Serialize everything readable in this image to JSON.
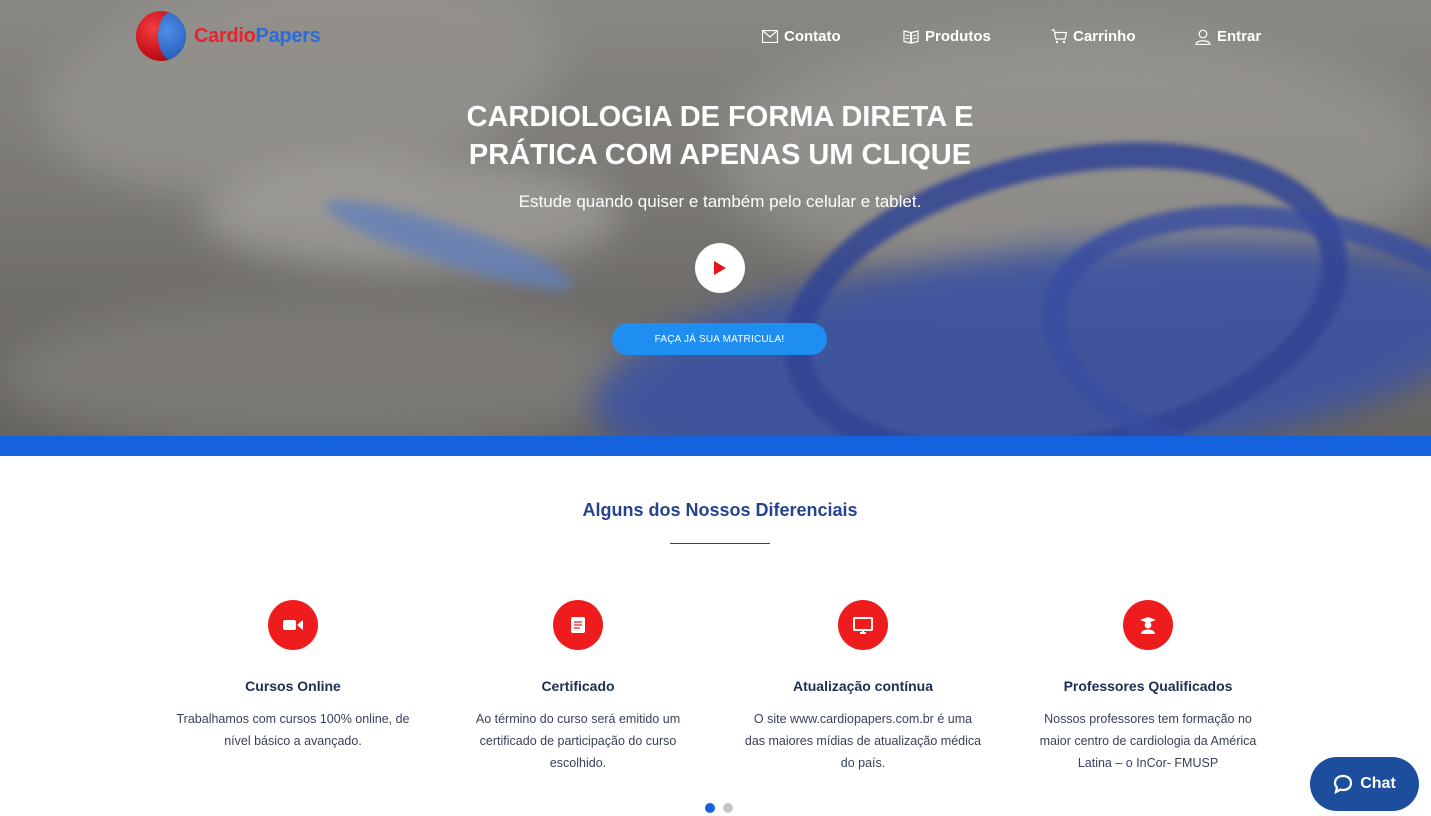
{
  "logo": {
    "part1": "Cardio",
    "part2": "Papers"
  },
  "nav": {
    "contato": {
      "label": "Contato",
      "icon": "envelope-icon"
    },
    "produtos": {
      "label": "Produtos",
      "icon": "book-icon"
    },
    "carrinho": {
      "label": "Carrinho",
      "icon": "cart-icon"
    },
    "entrar": {
      "label": "Entrar",
      "icon": "user-icon"
    }
  },
  "hero": {
    "title_line1": "CARDIOLOGIA DE FORMA DIRETA E",
    "title_line2": "PRÁTICA COM APENAS UM CLIQUE",
    "subtitle": "Estude quando quiser e também pelo celular e tablet.",
    "cta": "FAÇA JÁ SUA MATRICULA!"
  },
  "section": {
    "title": "Alguns dos Nossos Diferenciais"
  },
  "features": [
    {
      "icon": "video-camera-icon",
      "title": "Cursos Online",
      "desc": "Trabalhamos com cursos 100% online, de nível básico a avançado."
    },
    {
      "icon": "book-icon",
      "title": "Certificado",
      "desc": "Ao término do curso será emitido um certificado de participação do curso escolhido."
    },
    {
      "icon": "monitor-icon",
      "title": "Atualização contínua",
      "desc": "O site www.cardiopapers.com.br é uma das maiores mídias de atualização médica do país."
    },
    {
      "icon": "graduate-icon",
      "title": "Professores Qualificados",
      "desc": "Nossos professores tem formação no maior centro de cardiologia da América Latina – o InCor- FMUSP"
    }
  ],
  "carousel": {
    "pages": 2,
    "active": 1
  },
  "chat": {
    "label": "Chat"
  },
  "colors": {
    "accent_blue": "#1562df",
    "feature_red": "#ee1c1c",
    "title_navy": "#26448e",
    "chat_bg": "#1c4e9d"
  }
}
